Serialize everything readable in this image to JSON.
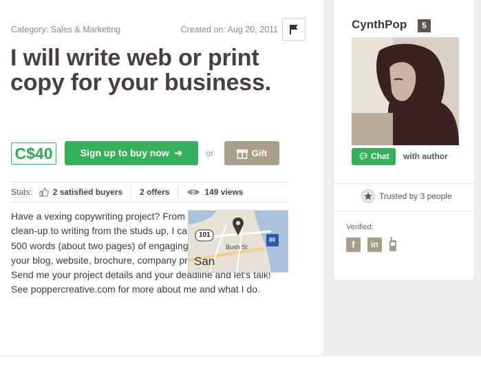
{
  "gig": {
    "category": "Category: Sales & Marketing",
    "created": "Created on: Aug 20, 2011",
    "title": "I will write web or print copy for your business.",
    "price": "C$40",
    "buy_label": "Sign up to buy now",
    "or_text": "or",
    "gift_label": "Gift",
    "description": "Have a vexing copywriting project? From simple marketing clean-up to writing from the studs up, I can compose up to 500 words (about two pages) of engaging, error-free copy for your blog, website, brochure, company profile...whatever. Send me your project details and your deadline and let's talk! See poppercreative.com for more about me and what I do."
  },
  "stats": {
    "label": "Stats:",
    "satisfied": "2 satisfied buyers",
    "offers": "2 offers",
    "views": "149 views"
  },
  "map": {
    "highway_101": "101",
    "highway_80": "80",
    "street": "Bush St",
    "city": "San"
  },
  "author": {
    "name": "CynthPop",
    "level": "5",
    "chat_label": "Chat",
    "with_author": "with author",
    "trusted": "Trusted by 3 people",
    "verified_label": "Verified:",
    "verify_icons": [
      "facebook-icon",
      "linkedin-icon",
      "phone-icon"
    ]
  },
  "colors": {
    "accent_green": "#35b15b",
    "gift_tan": "#a89e8a",
    "title_brown": "#4a3f3f"
  }
}
